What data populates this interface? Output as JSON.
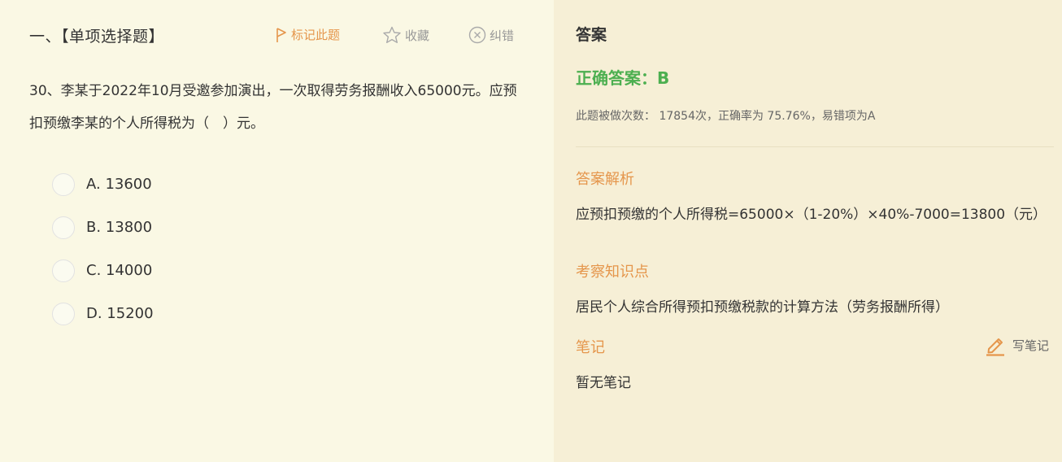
{
  "question": {
    "type_label": "一、【单项选择题】",
    "stem": "30、李某于2022年10月受邀参加演出，一次取得劳务报酬收入65000元。应预扣预缴李某的个人所得税为（　）元。",
    "options": [
      {
        "label": "A. 13600"
      },
      {
        "label": "B. 13800"
      },
      {
        "label": "C. 14000"
      },
      {
        "label": "D. 15200"
      }
    ]
  },
  "toolbar": {
    "mark_label": "标记此题",
    "favorite_label": "收藏",
    "report_label": "纠错",
    "mark_color": "#e5964c"
  },
  "answer": {
    "title": "答案",
    "correct_answer": "正确答案：B",
    "stats": "此题被做次数： 17854次，正确率为 75.76%，易错项为A",
    "analysis_title": "答案解析",
    "analysis_text": "应预扣预缴的个人所得税=65000×（1-20%）×40%-7000=13800（元）",
    "knowledge_title": "考察知识点",
    "knowledge_text": "居民个人综合所得预扣预缴税款的计算方法（劳务报酬所得）",
    "notes_title": "笔记",
    "write_note_label": "写笔记",
    "notes_text": "暂无笔记",
    "correct_color": "#4caf50",
    "section_color": "#e5964c"
  }
}
